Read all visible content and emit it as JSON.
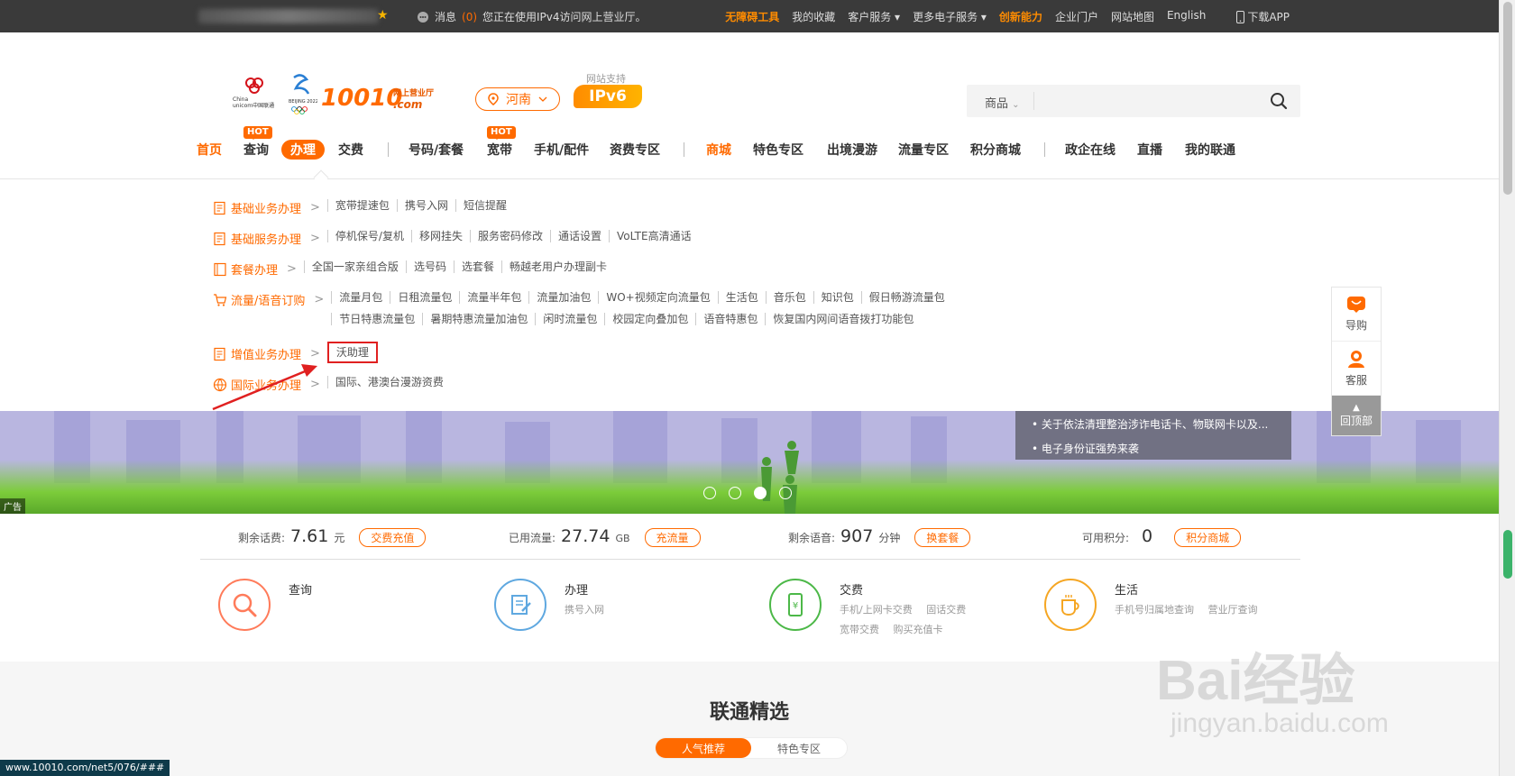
{
  "topbar": {
    "message_label": "消息",
    "message_count": "(0)",
    "ipv4_notice": "您正在使用IPv4访问网上营业厅。",
    "links": [
      {
        "label": "无障碍工具",
        "highlight": true
      },
      {
        "label": "我的收藏",
        "highlight": false
      },
      {
        "label": "客户服务 ▾",
        "highlight": false
      },
      {
        "label": "更多电子服务 ▾",
        "highlight": false
      },
      {
        "label": "创新能力",
        "highlight": true
      },
      {
        "label": "企业门户",
        "highlight": false
      },
      {
        "label": "网站地图",
        "highlight": false
      },
      {
        "label": "English",
        "highlight": false
      },
      {
        "label": "下载APP",
        "highlight": false
      }
    ]
  },
  "header": {
    "logo_text": "10010",
    "logo_sub": "网上营业厅",
    "logo_sub2": ".com",
    "region": "河南",
    "ipv6_label": "网站支持",
    "ipv6_badge": "IPv6",
    "search_scope": "商品",
    "search_placeholder": ""
  },
  "nav": {
    "items": [
      {
        "label": "首页",
        "style": "orange"
      },
      {
        "label": "查询",
        "hot": "HOT"
      },
      {
        "label": "办理",
        "style": "active"
      },
      {
        "label": "交费"
      },
      {
        "label": "号码/套餐"
      },
      {
        "label": "宽带",
        "hot": "HOT"
      },
      {
        "label": "手机/配件"
      },
      {
        "label": "资费专区"
      },
      {
        "label": "商城",
        "style": "orange"
      },
      {
        "label": "特色专区"
      },
      {
        "label": "出境漫游"
      },
      {
        "label": "流量专区"
      },
      {
        "label": "积分商城"
      },
      {
        "label": "政企在线"
      },
      {
        "label": "直播"
      },
      {
        "label": "我的联通"
      }
    ]
  },
  "menu": {
    "rows": [
      {
        "title": "基础业务办理",
        "links": [
          "宽带提速包",
          "携号入网",
          "短信提醒"
        ]
      },
      {
        "title": "基础服务办理",
        "links": [
          "停机保号/复机",
          "移网挂失",
          "服务密码修改",
          "通话设置",
          "VoLTE高清通话"
        ]
      },
      {
        "title": "套餐办理",
        "links": [
          "全国一家亲组合版",
          "选号码",
          "选套餐",
          "畅越老用户办理副卡"
        ]
      },
      {
        "title": "流量/语音订购",
        "links": [
          "流量月包",
          "日租流量包",
          "流量半年包",
          "流量加油包",
          "WO+视频定向流量包",
          "生活包",
          "音乐包",
          "知识包",
          "假日畅游流量包",
          "节日特惠流量包",
          "暑期特惠流量加油包",
          "闲时流量包",
          "校园定向叠加包",
          "语音特惠包",
          "恢复国内网间语音拨打功能包"
        ]
      },
      {
        "title": "增值业务办理",
        "links": [
          "沃助理"
        ]
      },
      {
        "title": "国际业务办理",
        "links": [
          "国际、港澳台漫游资费"
        ]
      }
    ]
  },
  "banner": {
    "news": [
      "• 关于依法清理整治涉诈电话卡、物联网卡以及...",
      "• 电子身份证强势来袭"
    ],
    "ad_label": "广告",
    "current_slide": 3,
    "slide_count": 4
  },
  "side": {
    "guide": "导购",
    "service": "客服",
    "top": "回顶部"
  },
  "stats": {
    "balance_label": "剩余话费:",
    "balance": "7.61",
    "balance_unit": "元",
    "balance_btn": "交费充值",
    "data_label": "已用流量:",
    "data": "27.74",
    "data_unit": "GB",
    "data_btn": "充流量",
    "voice_label": "剩余语音:",
    "voice": "907",
    "voice_unit": "分钟",
    "voice_btn": "换套餐",
    "points_label": "可用积分:",
    "points": "0",
    "points_btn": "积分商城"
  },
  "services": [
    {
      "title": "查询",
      "links": []
    },
    {
      "title": "办理",
      "links": [
        "携号入网"
      ]
    },
    {
      "title": "交费",
      "links": [
        "手机/上网卡交费",
        "固话交费",
        "宽带交费",
        "购买充值卡"
      ]
    },
    {
      "title": "生活",
      "links": [
        "手机号归属地查询",
        "营业厅查询"
      ]
    }
  ],
  "selection": {
    "title": "联通精选",
    "tabs": [
      "人气推荐",
      "特色专区"
    ]
  },
  "status_url": "www.10010.com/net5/076/###",
  "watermark": {
    "main": "Bai经验",
    "sub": "jingyan.baidu.com"
  },
  "colors": {
    "brand": "#ff6a00",
    "highlight_box": "#e02020"
  }
}
